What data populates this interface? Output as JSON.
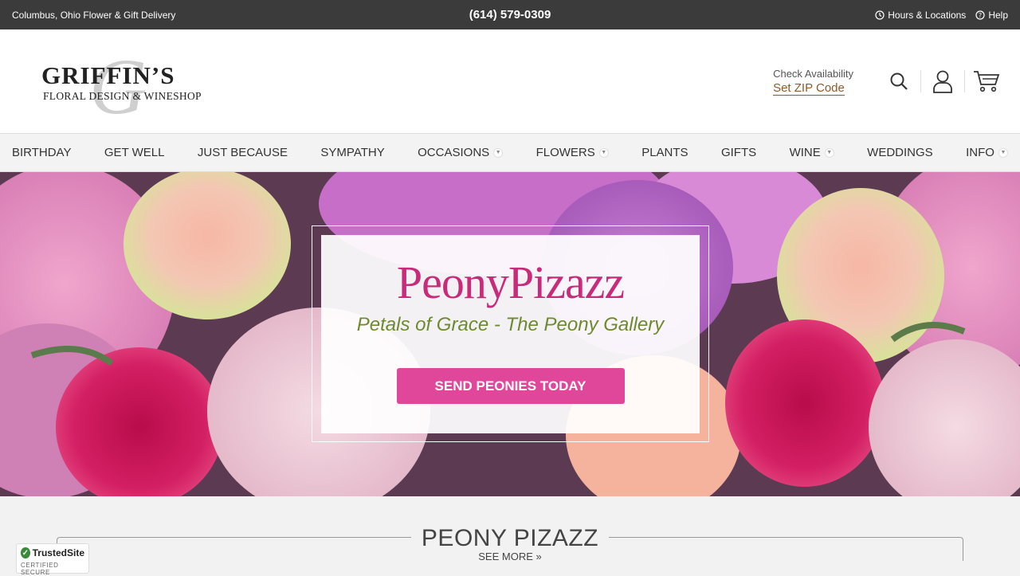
{
  "topbar": {
    "location": "Columbus, Ohio Flower & Gift Delivery",
    "phone": "(614) 579-0309",
    "hours_label": "Hours & Locations",
    "help_label": "Help"
  },
  "logo": {
    "name": "GRIFFIN’S",
    "subtitle": "FLORAL DESIGN & WINESHOP",
    "monogram": "G"
  },
  "header": {
    "check_availability": "Check Availability",
    "set_zip": "Set ZIP Code",
    "icons": [
      "search-icon",
      "account-icon",
      "cart-icon"
    ]
  },
  "nav": {
    "items": [
      {
        "label": "BIRTHDAY"
      },
      {
        "label": "GET WELL"
      },
      {
        "label": "JUST BECAUSE"
      },
      {
        "label": "SYMPATHY"
      },
      {
        "label": "OCCASIONS"
      },
      {
        "label": "FLOWERS"
      },
      {
        "label": "PLANTS"
      },
      {
        "label": "GIFTS"
      },
      {
        "label": "WINE"
      },
      {
        "label": "WEDDINGS"
      },
      {
        "label": "INFO"
      }
    ]
  },
  "hero": {
    "title": "PeonyPizazz",
    "subtitle": "Petals of Grace - The Peony Gallery",
    "cta": "SEND PEONIES TODAY"
  },
  "section": {
    "heading": "PEONY PIZAZZ",
    "see_more": "SEE MORE »"
  },
  "badge": {
    "name": "TrustedSite",
    "tagline": "CERTIFIED SECURE"
  },
  "colors": {
    "topbar": "#3b3b3b",
    "brand_pink": "#e0479b",
    "title_pink": "#c72b7a",
    "subtitle_green": "#6e8a2e",
    "zip_link": "#8c5a2b"
  }
}
